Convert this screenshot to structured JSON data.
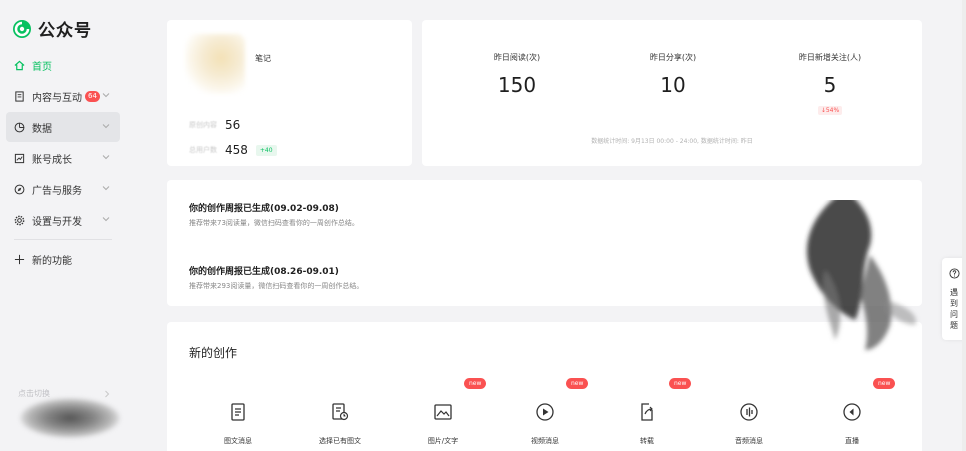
{
  "brand": {
    "name": "公众号",
    "accent": "#07c160"
  },
  "sidebar": {
    "items": [
      {
        "label": "首页",
        "icon": "home-icon",
        "active": true,
        "badge": "",
        "chevron": false
      },
      {
        "label": "内容与互动",
        "icon": "document-icon",
        "active": false,
        "badge": "64",
        "chevron": true
      },
      {
        "label": "数据",
        "icon": "chart-circle-icon",
        "active": false,
        "badge": "",
        "chevron": true
      },
      {
        "label": "账号成长",
        "icon": "growth-icon",
        "active": false,
        "badge": "",
        "chevron": true
      },
      {
        "label": "广告与服务",
        "icon": "compass-icon",
        "active": false,
        "badge": "",
        "chevron": true
      },
      {
        "label": "设置与开发",
        "icon": "gear-icon",
        "active": false,
        "badge": "",
        "chevron": true
      }
    ],
    "new_feature": "新的功能",
    "bottom_label": "点击切换"
  },
  "profile": {
    "account_suffix": "笔记",
    "rows": [
      {
        "label": "原创内容",
        "value": "56",
        "tag": ""
      },
      {
        "label": "总用户数",
        "value": "458",
        "tag": "+40"
      }
    ]
  },
  "stats": {
    "items": [
      {
        "label": "昨日阅读(次)",
        "value": "150",
        "delta": ""
      },
      {
        "label": "昨日分享(次)",
        "value": "10",
        "delta": ""
      },
      {
        "label": "昨日新增关注(人)",
        "value": "5",
        "delta": "↓54%"
      }
    ],
    "footnote": "数据统计时间: 9月13日 00:00 - 24:00, 数据统计时间: 昨日"
  },
  "reports": [
    {
      "title": "你的创作周报已生成(09.02-09.08)",
      "subtitle": "推荐带来73阅读量，微信扫码查看你的一周创作总结。"
    },
    {
      "title": "你的创作周报已生成(08.26-09.01)",
      "subtitle": "推荐带来293阅读量，微信扫码查看你的一周创作总结。"
    }
  ],
  "create": {
    "title": "新的创作",
    "tools": [
      {
        "label": "图文消息",
        "icon": "article-icon",
        "is_new": false
      },
      {
        "label": "选择已有图文",
        "icon": "article-history-icon",
        "is_new": false
      },
      {
        "label": "图片/文字",
        "icon": "image-icon",
        "is_new": true
      },
      {
        "label": "视频消息",
        "icon": "play-icon",
        "is_new": true
      },
      {
        "label": "转载",
        "icon": "repost-icon",
        "is_new": true
      },
      {
        "label": "音频消息",
        "icon": "audio-icon",
        "is_new": false
      },
      {
        "label": "直播",
        "icon": "live-icon",
        "is_new": true
      }
    ],
    "new_tag": "new"
  },
  "help": {
    "label": "遇到问题"
  }
}
